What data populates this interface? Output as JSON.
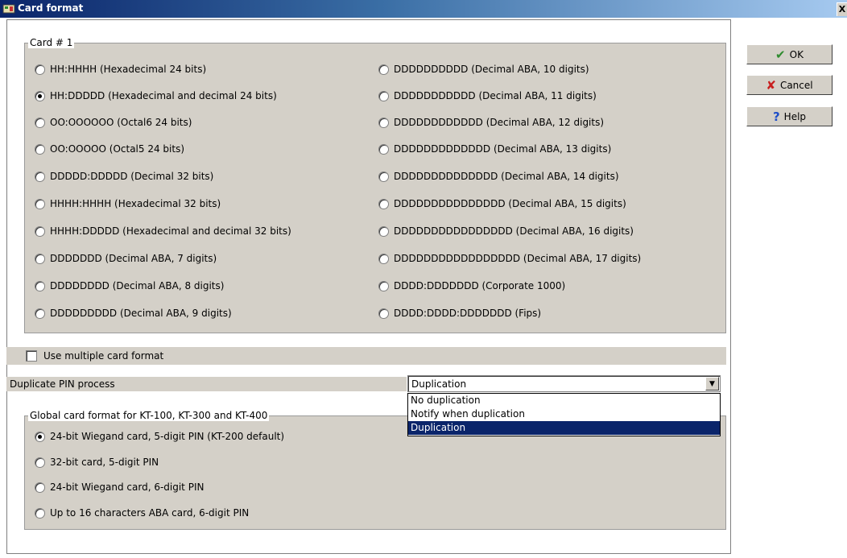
{
  "window": {
    "title": "Card format",
    "close_glyph": "X"
  },
  "card_group": {
    "legend": "Card # 1",
    "left_options": [
      {
        "label": "HH:HHHH (Hexadecimal 24 bits)",
        "checked": false
      },
      {
        "label": "HH:DDDDD (Hexadecimal and decimal 24 bits)",
        "checked": true
      },
      {
        "label": "OO:OOOOOO (Octal6 24 bits)",
        "checked": false
      },
      {
        "label": "OO:OOOOO (Octal5 24 bits)",
        "checked": false
      },
      {
        "label": "DDDDD:DDDDD (Decimal 32 bits)",
        "checked": false
      },
      {
        "label": "HHHH:HHHH (Hexadecimal 32 bits)",
        "checked": false
      },
      {
        "label": "HHHH:DDDDD (Hexadecimal and decimal 32 bits)",
        "checked": false
      },
      {
        "label": "DDDDDDD (Decimal ABA, 7 digits)",
        "checked": false
      },
      {
        "label": "DDDDDDDD (Decimal ABA, 8 digits)",
        "checked": false
      },
      {
        "label": "DDDDDDDDD (Decimal ABA, 9 digits)",
        "checked": false
      }
    ],
    "right_options": [
      {
        "label": "DDDDDDDDDD (Decimal ABA, 10 digits)",
        "checked": false
      },
      {
        "label": "DDDDDDDDDDD (Decimal ABA, 11 digits)",
        "checked": false
      },
      {
        "label": "DDDDDDDDDDDD (Decimal ABA, 12 digits)",
        "checked": false
      },
      {
        "label": "DDDDDDDDDDDDD (Decimal ABA, 13 digits)",
        "checked": false
      },
      {
        "label": "DDDDDDDDDDDDDD (Decimal ABA, 14 digits)",
        "checked": false
      },
      {
        "label": "DDDDDDDDDDDDDDD (Decimal ABA, 15 digits)",
        "checked": false
      },
      {
        "label": "DDDDDDDDDDDDDDDD (Decimal ABA, 16 digits)",
        "checked": false
      },
      {
        "label": "DDDDDDDDDDDDDDDDD (Decimal ABA, 17 digits)",
        "checked": false
      },
      {
        "label": "DDDD:DDDDDDD (Corporate 1000)",
        "checked": false
      },
      {
        "label": "DDDD:DDDD:DDDDDDD (Fips)",
        "checked": false
      }
    ]
  },
  "multiple_format": {
    "label": "Use multiple card format",
    "checked": false
  },
  "duplicate_pin": {
    "label": "Duplicate PIN process",
    "selected": "Duplication",
    "options": [
      "No duplication",
      "Notify when duplication",
      "Duplication"
    ],
    "highlighted_index": 2
  },
  "global_group": {
    "legend": "Global card format for KT-100, KT-300 and KT-400",
    "options": [
      {
        "label": "24-bit Wiegand card, 5-digit PIN (KT-200 default)",
        "checked": true
      },
      {
        "label": "32-bit card, 5-digit PIN",
        "checked": false
      },
      {
        "label": "24-bit Wiegand card, 6-digit PIN",
        "checked": false
      },
      {
        "label": "Up to 16 characters ABA card, 6-digit PIN",
        "checked": false
      }
    ]
  },
  "buttons": {
    "ok": {
      "label": "OK",
      "icon": "checkmark-icon"
    },
    "cancel": {
      "label": "Cancel",
      "icon": "x-icon"
    },
    "help": {
      "label": "Help",
      "icon": "question-icon"
    }
  },
  "colors": {
    "face": "#d4d0c8",
    "title_start": "#0a246a",
    "title_end": "#a6caf0",
    "selection": "#0a246a"
  }
}
